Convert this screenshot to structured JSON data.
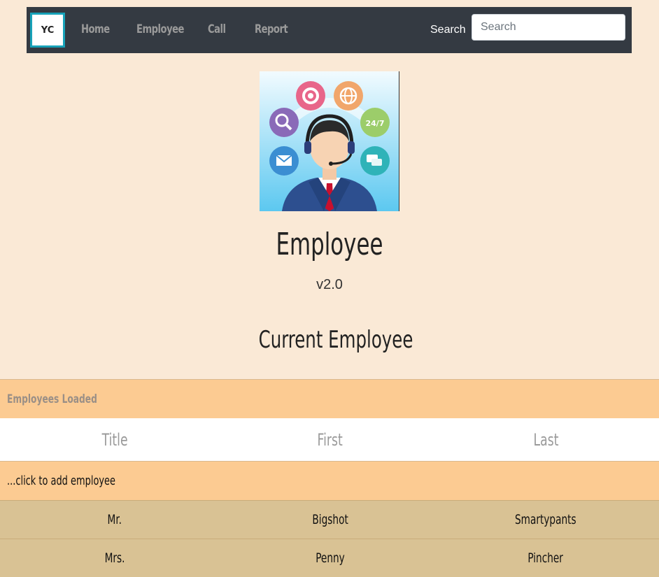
{
  "navbar": {
    "logo_text": "YC",
    "links": [
      {
        "label": "Home"
      },
      {
        "label": "Employee"
      },
      {
        "label": "Call"
      },
      {
        "label": "Report"
      }
    ],
    "search_label": "Search",
    "search_placeholder": "Search",
    "colors": {
      "background": "#343a42",
      "logo_border": "#17a2b8"
    }
  },
  "hero": {
    "image": "call-center-agent-illustration",
    "title": "Employee",
    "version": "v2.0"
  },
  "section": {
    "title": "Current Employee"
  },
  "table": {
    "caption": "Employees Loaded",
    "columns": [
      "Title",
      "First",
      "Last"
    ],
    "add_prompt": "...click to add employee",
    "rows": [
      {
        "title": "Mr.",
        "first": "Bigshot",
        "last": "Smartypants"
      },
      {
        "title": "Mrs.",
        "first": "Penny",
        "last": "Pincher"
      }
    ],
    "colors": {
      "caption_bg": "#fccb92",
      "row_bg": "#d9c294",
      "page_bg": "#fae9d6"
    }
  }
}
